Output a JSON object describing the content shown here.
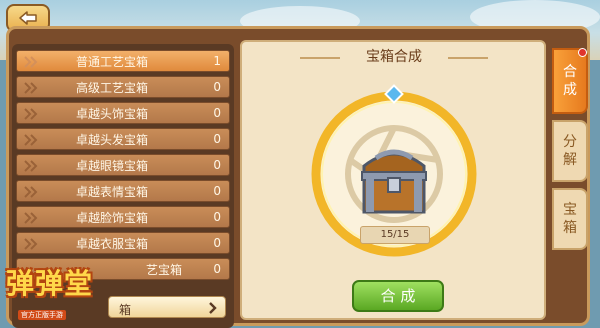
{
  "header": {
    "back_icon": "back-arrow-icon"
  },
  "list": {
    "items": [
      {
        "name": "普通工艺宝箱",
        "count": "1",
        "active": true
      },
      {
        "name": "高级工艺宝箱",
        "count": "0",
        "active": false
      },
      {
        "name": "卓越头饰宝箱",
        "count": "0",
        "active": false
      },
      {
        "name": "卓越头发宝箱",
        "count": "0",
        "active": false
      },
      {
        "name": "卓越眼镜宝箱",
        "count": "0",
        "active": false
      },
      {
        "name": "卓越表情宝箱",
        "count": "0",
        "active": false
      },
      {
        "name": "卓越脸饰宝箱",
        "count": "0",
        "active": false
      },
      {
        "name": "卓越衣服宝箱",
        "count": "0",
        "active": false
      },
      {
        "name": "艺宝箱",
        "count": "0",
        "active": false
      }
    ],
    "more_label": "箱",
    "more_icon": "chevron-right-icon"
  },
  "synth": {
    "title": "宝箱合成",
    "progress": "15/15",
    "combine_label": "合 成",
    "chest_icon": "treasure-chest-icon"
  },
  "tabs": [
    {
      "label": "合成",
      "active": true
    },
    {
      "label": "分解",
      "active": false
    },
    {
      "label": "宝箱",
      "active": false
    }
  ],
  "logo": {
    "title": "弹弹堂",
    "subtitle": "官方正版手游"
  },
  "colors": {
    "accent": "#f9a13a",
    "button_green": "#5aa823",
    "panel_brown": "#7a4c2b",
    "ring_gold": "#f2b628"
  }
}
